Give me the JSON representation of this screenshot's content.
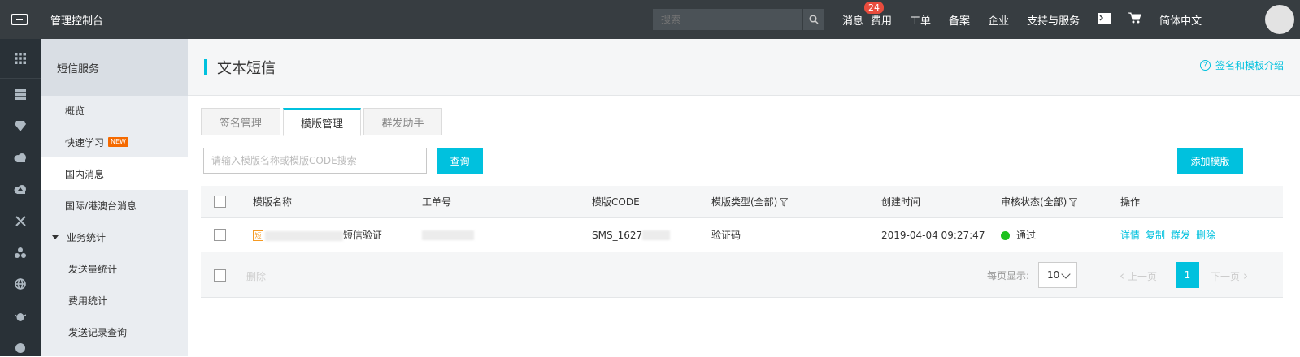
{
  "topbar": {
    "console_title": "管理控制台",
    "search_placeholder": "搜索",
    "nav": {
      "messages": "消息",
      "message_count": "24",
      "billing": "费用",
      "tickets": "工单",
      "icp": "备案",
      "enterprise": "企业",
      "support": "支持与服务",
      "language": "简体中文"
    }
  },
  "sidebar": {
    "title": "短信服务",
    "items": {
      "overview": "概览",
      "quick_learn": "快速学习",
      "new_badge": "NEW",
      "domestic": "国内消息",
      "international": "国际/港澳台消息",
      "stats": "业务统计",
      "send_stats": "发送量统计",
      "cost_stats": "费用统计",
      "send_log": "发送记录查询"
    }
  },
  "main": {
    "page_title": "文本短信",
    "help_link": "签名和模板介绍",
    "tabs": {
      "signature": "签名管理",
      "template": "模版管理",
      "bulk": "群发助手"
    },
    "search_placeholder": "请输入模版名称或模版CODE搜索",
    "query_button": "查询",
    "add_button": "添加模版"
  },
  "table": {
    "headers": {
      "name": "模版名称",
      "ticket": "工单号",
      "code": "模版CODE",
      "type": "模版类型(全部)",
      "created": "创建时间",
      "status": "审核状态(全部)",
      "actions": "操作"
    },
    "rows": [
      {
        "name_icon": "短",
        "name_suffix": "短信验证",
        "code": "SMS_1627",
        "type": "验证码",
        "created": "2019-04-04 09:27:47",
        "status": "通过",
        "actions": {
          "detail": "详情",
          "copy": "复制",
          "bulk": "群发",
          "delete": "删除"
        }
      }
    ],
    "footer": {
      "delete": "删除",
      "per_page_label": "每页显示:",
      "per_page": "10",
      "prev": "上一页",
      "current_page": "1",
      "next": "下一页"
    }
  },
  "colors": {
    "accent": "#00c1de",
    "topbar": "#373d41",
    "iconbar": "#293137",
    "status_ok": "#1dc11d"
  }
}
